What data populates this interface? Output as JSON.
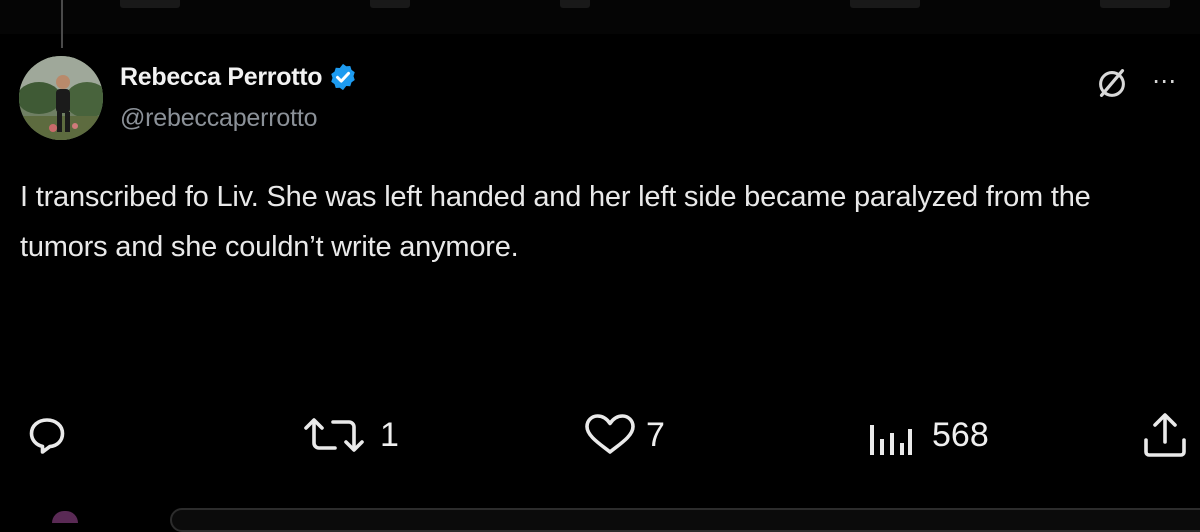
{
  "post": {
    "author": {
      "display_name": "Rebecca Perrotto",
      "handle": "@rebeccaperrotto",
      "verified": true
    },
    "text": "I transcribed fo Liv. She was left handed and her left side became paralyzed from the tumors and she couldn’t write anymore.",
    "actions": {
      "reply": {
        "icon": "reply-icon",
        "count": ""
      },
      "repost": {
        "icon": "repost-icon",
        "count": "1"
      },
      "like": {
        "icon": "heart-icon",
        "count": "7"
      },
      "views": {
        "icon": "views-icon",
        "count": "568"
      },
      "share": {
        "icon": "share-icon",
        "count": ""
      }
    }
  },
  "header_icons": {
    "grok": "grok-icon",
    "more": "⋯"
  },
  "colors": {
    "background": "#000000",
    "text": "#e7e9ea",
    "secondary_text": "#8b9198",
    "verified": "#1d9bf0"
  }
}
